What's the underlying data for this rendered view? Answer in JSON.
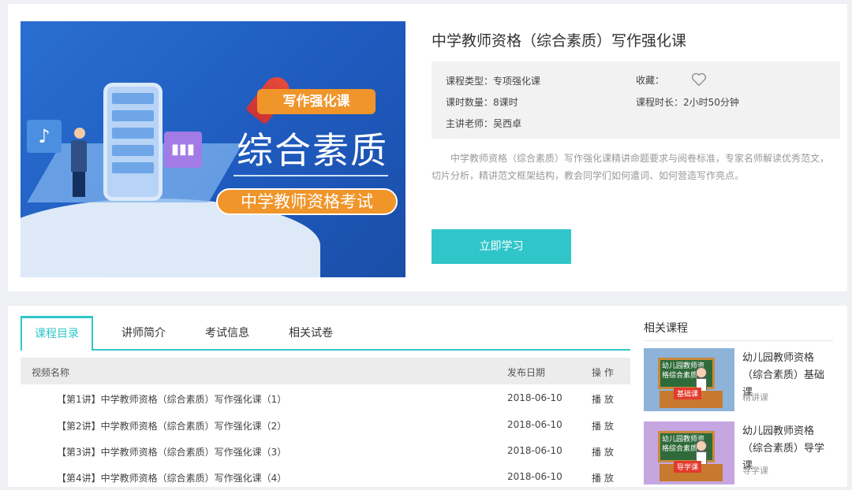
{
  "course": {
    "banner": {
      "tag": "写作强化课",
      "headline": "综合素质",
      "exam": "中学教师资格考试"
    },
    "title": "中学教师资格（综合素质）写作强化课",
    "meta": {
      "type_label": "课程类型：",
      "type_value": "专项强化课",
      "favorite_label": "收藏：",
      "hours_label": "课时数量：",
      "hours_value": "8课时",
      "duration_label": "课程时长：",
      "duration_value": "2小时50分钟",
      "teacher_label": "主讲老师：",
      "teacher_value": "吴西卓"
    },
    "description": "中学教师资格（综合素质）写作强化课精讲命题要求与阅卷标准，专家名师解读优秀范文，切片分析，精讲范文框架结构，教会同学们如何遣词、如何营造写作亮点。",
    "study_button": "立即学习"
  },
  "tabs": [
    "课程目录",
    "讲师简介",
    "考试信息",
    "相关试卷"
  ],
  "table": {
    "headers": [
      "视频名称",
      "发布日期",
      "操 作"
    ],
    "rows": [
      {
        "name": "【第1讲】中学教师资格（综合素质）写作强化课（1）",
        "date": "2018-06-10",
        "action": "播 放"
      },
      {
        "name": "【第2讲】中学教师资格（综合素质）写作强化课（2）",
        "date": "2018-06-10",
        "action": "播 放"
      },
      {
        "name": "【第3讲】中学教师资格（综合素质）写作强化课（3）",
        "date": "2018-06-10",
        "action": "播 放"
      },
      {
        "name": "【第4讲】中学教师资格（综合素质）写作强化课（4）",
        "date": "2018-06-10",
        "action": "播 放"
      }
    ]
  },
  "related": {
    "title": "相关课程",
    "items": [
      {
        "name": "幼儿园教师资格（综合素质）基础课",
        "sub": "精讲课",
        "board_text": "幼儿园教师资格综合素质",
        "desk_text": "基础课",
        "bg": "#8eb3d9"
      },
      {
        "name": "幼儿园教师资格（综合素质）导学课",
        "sub": "导学课",
        "board_text": "幼儿园教师资格综合素质",
        "desk_text": "导学课",
        "bg": "#c6a6e0"
      }
    ]
  },
  "colors": {
    "accent": "#30c6c9"
  }
}
